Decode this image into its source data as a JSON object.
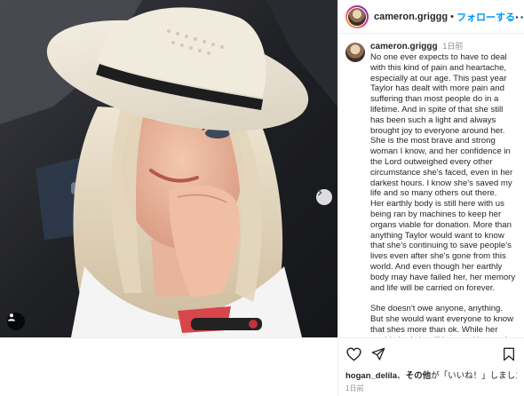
{
  "post": {
    "username": "cameron.griggg",
    "separator": "•",
    "follow_label": "フォローする",
    "more_label": "···"
  },
  "caption": {
    "username": "cameron.griggg",
    "time": "1日前",
    "text": "No one ever expects to have to deal with this kind of pain and heartache, especially at our age. This past year Taylor has dealt with more pain and suffering than most people do in a lifetime. And in spite of that she still has been such a light and always brought joy to everyone around her. She is the most brave and strong woman I know, and her confidence in the Lord outweighed every other circumstance she's faced, even in her darkest hours. I know she's saved my life and so many others out there.\nHer earthly body is still here with us being ran by machines to keep her organs viable for donation. More than anything Taylor would want to know that she's continuing to save people's lives even after she's gone from this world. And even though her earthly body may have failed her, her memory and life will be carried on forever.\n\nShe doesn't owe anyone, anything. But she would want everyone to know that shes more than ok. While her earthly body is still here waiting to give the gift of life and a second chance to"
  },
  "likes": {
    "first_user": "hogan_delila",
    "connector": "、",
    "others": "その他",
    "suffix": "が「いいね！」しました"
  },
  "timestamp": "1日前",
  "icons": {
    "like": "heart-icon",
    "share": "paper-plane-icon",
    "save": "bookmark-icon",
    "next": "chevron-right-icon",
    "tags": "user-tag-icon"
  },
  "colors": {
    "follow": "#0095f6",
    "border": "#efefef",
    "muted": "#8e8e8e"
  }
}
